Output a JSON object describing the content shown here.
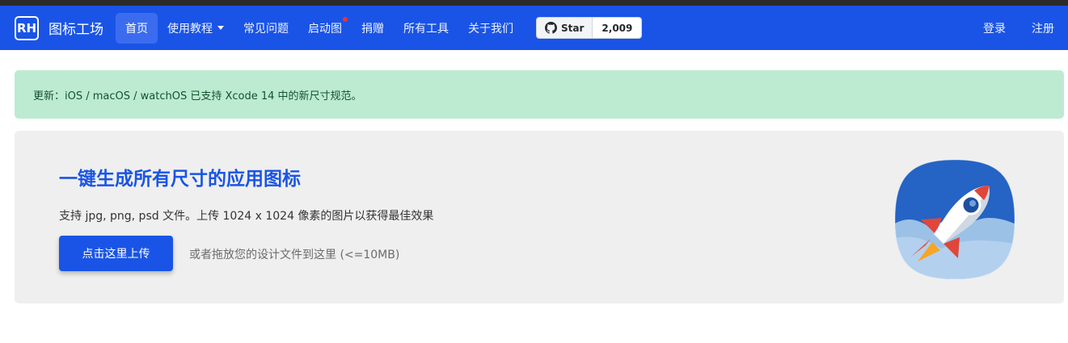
{
  "brand": {
    "logo_text": "RH",
    "name": "图标工场"
  },
  "nav": {
    "items": [
      {
        "label": "首页",
        "active": true
      },
      {
        "label": "使用教程",
        "dropdown": true
      },
      {
        "label": "常见问题"
      },
      {
        "label": "启动图",
        "badge_dot": true
      },
      {
        "label": "捐赠"
      },
      {
        "label": "所有工具"
      },
      {
        "label": "关于我们"
      }
    ],
    "github": {
      "star_label": "Star",
      "star_count": "2,009"
    },
    "login_label": "登录",
    "register_label": "注册"
  },
  "alert": {
    "text": "更新：iOS / macOS / watchOS 已支持 Xcode 14 中的新尺寸规范。"
  },
  "hero": {
    "title": "一键生成所有尺寸的应用图标",
    "subtitle": "支持 jpg, png, psd 文件。上传 1024 x 1024 像素的图片以获得最佳效果",
    "upload_button": "点击这里上传",
    "drop_hint": "或者拖放您的设计文件到这里 (<=10MB)",
    "icon_name": "rocket-app-icon"
  },
  "colors": {
    "primary": "#1a54e6",
    "alert_bg": "#bdebd2",
    "alert_text": "#14532d",
    "hero_bg": "#efefef"
  }
}
